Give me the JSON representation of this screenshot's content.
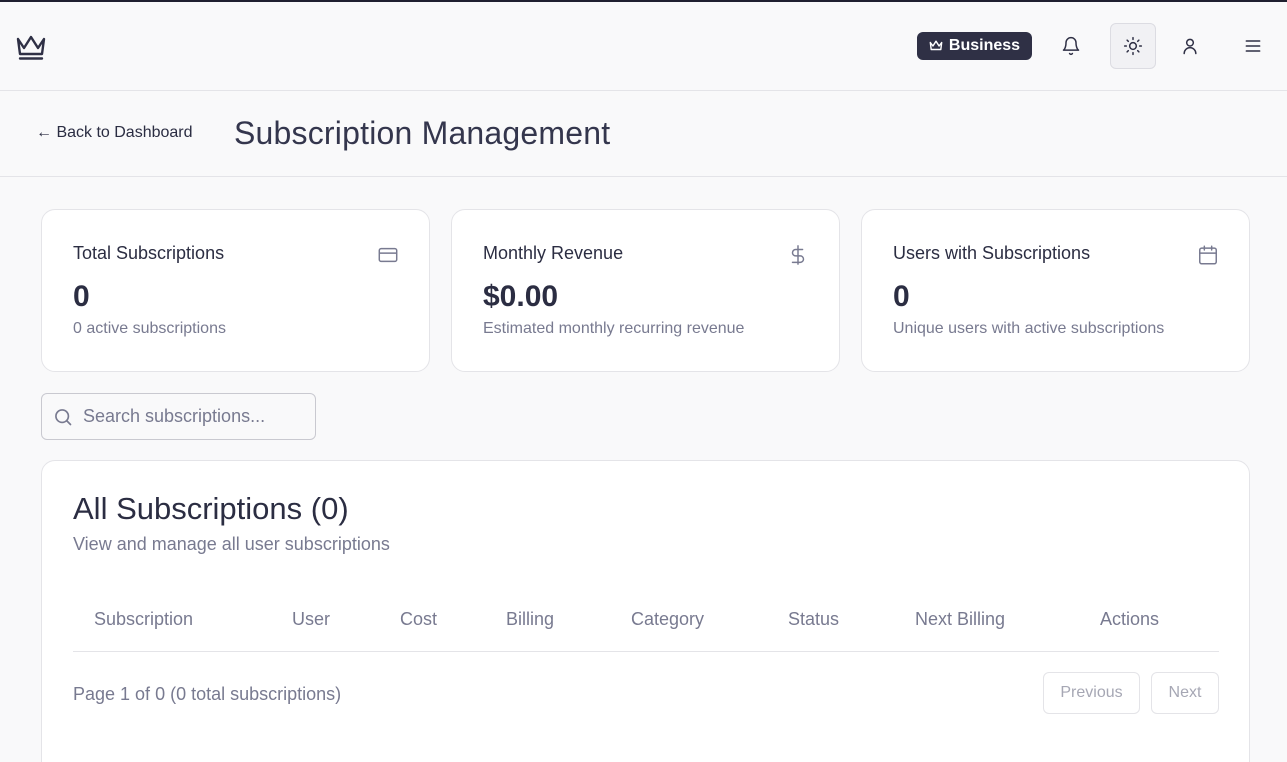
{
  "topbar": {
    "logo_icon": "crown-icon",
    "plan_badge": "Business",
    "icons": [
      "bell-icon",
      "sun-icon",
      "user-icon",
      "menu-icon"
    ]
  },
  "header": {
    "back_link": "← Back to Dashboard",
    "title": "Subscription Management"
  },
  "stats": [
    {
      "title": "Total Subscriptions",
      "value": "0",
      "sub": "0 active subscriptions",
      "icon": "credit-card-icon"
    },
    {
      "title": "Monthly Revenue",
      "value": "$0.00",
      "sub": "Estimated monthly recurring revenue",
      "icon": "dollar-icon"
    },
    {
      "title": "Users with Subscriptions",
      "value": "0",
      "sub": "Unique users with active subscriptions",
      "icon": "calendar-icon"
    }
  ],
  "search": {
    "placeholder": "Search subscriptions..."
  },
  "table": {
    "title": "All Subscriptions (0)",
    "subtitle": "View and manage all user subscriptions",
    "columns": [
      "Subscription",
      "User",
      "Cost",
      "Billing",
      "Category",
      "Status",
      "Next Billing",
      "Actions"
    ],
    "rows": [],
    "pagination": {
      "text": "Page 1 of 0 (0 total subscriptions)",
      "previous": "Previous",
      "next": "Next"
    }
  },
  "colors": {
    "badge_bg": "#2f3045",
    "text": "#2b2d42",
    "muted": "#787a90",
    "border": "#e4e4e8"
  }
}
